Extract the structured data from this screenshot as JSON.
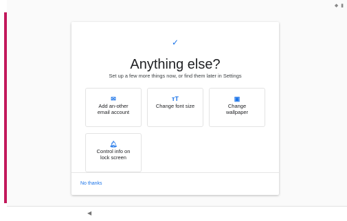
{
  "status_bar": {
    "icons": "◆ ▮"
  },
  "dialog": {
    "check_icon": "✓",
    "title": "Anything else?",
    "subtitle": "Set up a few more things now, or find them later in Settings",
    "tiles": [
      {
        "icon": "envelope-icon",
        "glyph": "✉",
        "label": "Add an-other email account"
      },
      {
        "icon": "font-size-icon",
        "glyph": "ᴛT",
        "label": "Change font size"
      },
      {
        "icon": "wallpaper-icon",
        "glyph": "▣",
        "label": "Change wallpaper"
      },
      {
        "icon": "bell-icon",
        "glyph": "🔔︎",
        "label": "Control info on lock screen"
      }
    ],
    "no_thanks": "No thanks"
  },
  "nav": {
    "back_glyph": "◀"
  },
  "colors": {
    "accent": "#1a73e8",
    "side_bar": "#c2185b"
  }
}
